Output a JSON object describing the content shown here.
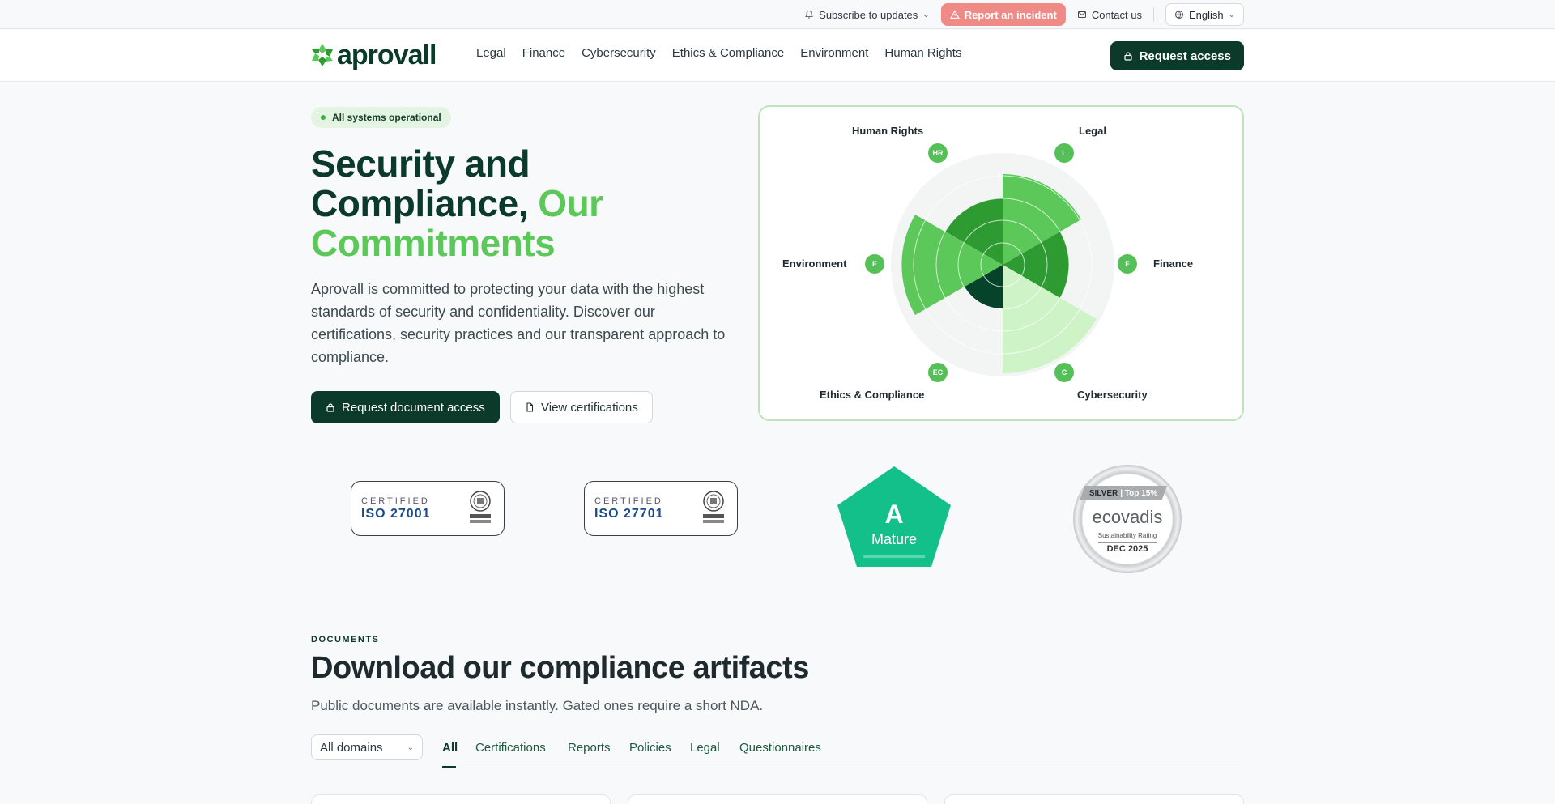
{
  "utility": {
    "subscribe": "Subscribe to updates",
    "report": "Report an incident",
    "contact": "Contact us",
    "language": "English"
  },
  "nav": {
    "logo_text": "aprovall",
    "links": [
      "Legal",
      "Finance",
      "Cybersecurity",
      "Ethics & Compliance",
      "Environment",
      "Human Rights"
    ],
    "request_access": "Request access"
  },
  "hero": {
    "status": "All systems operational",
    "title_line1": "Security and",
    "title_line2": "Compliance,",
    "title_accent1": "Our",
    "title_accent2": "Commitments",
    "description": "Aprovall is committed to protecting your data with the highest standards of security and confidentiality. Discover our certifications, security practices and our transparent approach to compliance.",
    "primary_cta": "Request document access",
    "secondary_cta": "View certifications"
  },
  "radar": {
    "domains": [
      {
        "name": "Legal",
        "abbr": "L"
      },
      {
        "name": "Finance",
        "abbr": "F"
      },
      {
        "name": "Cybersecurity",
        "abbr": "C"
      },
      {
        "name": "Ethics & Compliance",
        "abbr": "EC"
      },
      {
        "name": "Environment",
        "abbr": "E"
      },
      {
        "name": "Human Rights",
        "abbr": "HR"
      }
    ],
    "colors": {
      "light": "#cdf3c6",
      "mid": "#5cc85a",
      "dark": "#2e9a32",
      "darkest": "#05442a",
      "bg": "#f3f4f4"
    }
  },
  "certifications": {
    "iso1_kicker": "CERTIFIED",
    "iso1_name": "ISO 27001",
    "iso2_kicker": "CERTIFIED",
    "iso2_name": "ISO 27701",
    "rating_grade": "A",
    "rating_label": "Mature",
    "ecovadis_level": "SILVER",
    "ecovadis_rank": "| Top 15%",
    "ecovadis_name": "ecovadis",
    "ecovadis_sub": "Sustainability Rating",
    "ecovadis_date": "DEC 2025"
  },
  "documents": {
    "kicker": "DOCUMENTS",
    "title": "Download our compliance artifacts",
    "description": "Public documents are available instantly. Gated ones require a short NDA.",
    "domain_filter": "All domains",
    "tabs": [
      "All",
      "Certifications",
      "Reports",
      "Policies",
      "Legal",
      "Questionnaires"
    ]
  }
}
